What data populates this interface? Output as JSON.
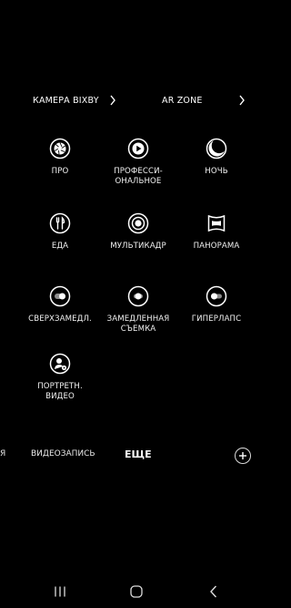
{
  "shortcuts": {
    "bixby": "КАМЕРА BIXBY",
    "ar_zone": "AR ZONE"
  },
  "modes": [
    {
      "label_lines": [
        "ПРО"
      ],
      "icon": "aperture-icon"
    },
    {
      "label_lines": [
        "ПРОФЕССИ-",
        "ОНАЛЬНОЕ"
      ],
      "icon": "pro-video-icon"
    },
    {
      "label_lines": [
        "НОЧЬ"
      ],
      "icon": "moon-icon"
    },
    {
      "label_lines": [
        "ЕДА"
      ],
      "icon": "food-icon"
    },
    {
      "label_lines": [
        "МУЛЬТИКАДР"
      ],
      "icon": "single-take-icon"
    },
    {
      "label_lines": [
        "ПАНОРАМА"
      ],
      "icon": "panorama-icon"
    },
    {
      "label_lines": [
        "СВЕРХЗАМЕДЛ."
      ],
      "icon": "super-slow-mo-icon"
    },
    {
      "label_lines": [
        "ЗАМЕДЛЕННАЯ",
        "СЪЕМКА"
      ],
      "icon": "slow-motion-icon"
    },
    {
      "label_lines": [
        "ГИПЕРЛАПС"
      ],
      "icon": "hyperlapse-icon"
    },
    {
      "label_lines": [
        "ПОРТРЕТН.",
        "ВИДЕО"
      ],
      "icon": "portrait-video-icon"
    }
  ],
  "mode_bar": {
    "partial": "Я",
    "video": "ВИДЕОЗАПИСЬ",
    "more": "ЕЩЕ"
  },
  "colors": {
    "background": "#000000",
    "text": "#ffffff"
  }
}
